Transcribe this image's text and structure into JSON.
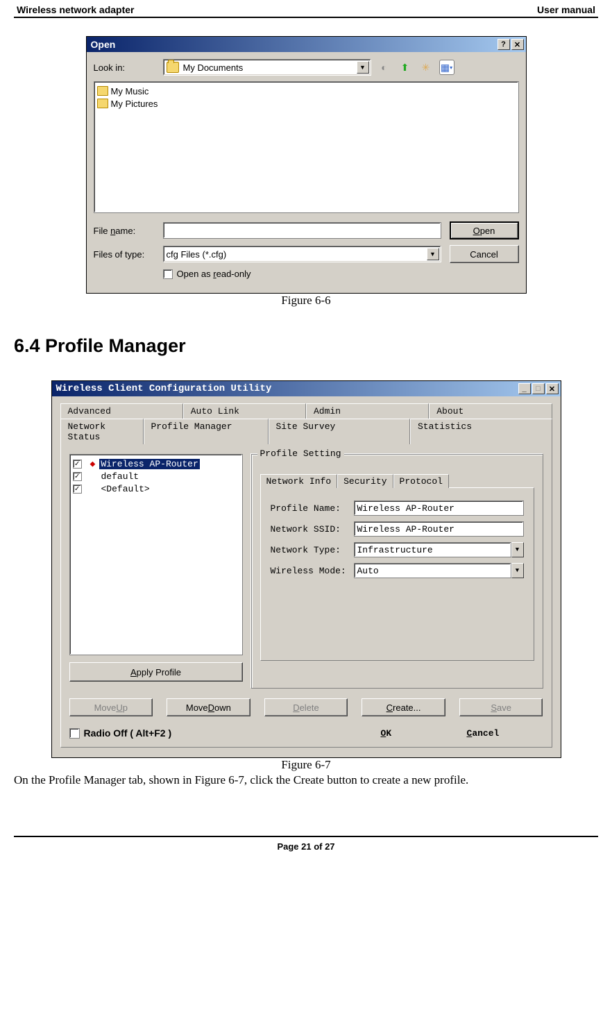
{
  "header": {
    "left": "Wireless network adapter",
    "right": "User manual"
  },
  "open_dialog": {
    "title": "Open",
    "look_in_label": "Look in:",
    "look_in_value": "My Documents",
    "files": [
      "My Music",
      "My Pictures"
    ],
    "filename_label": "File name:",
    "filename_value": "",
    "filetype_label": "Files of type:",
    "filetype_value": "cfg Files (*.cfg)",
    "readonly_label": "Open as read-only",
    "open_btn": "Open",
    "cancel_btn": "Cancel"
  },
  "fig1_caption": "Figure 6-6",
  "section_heading": "6.4 Profile Manager",
  "pm_dialog": {
    "title": "Wireless Client Configuration Utility",
    "tabs_top": [
      "Advanced",
      "Auto Link",
      "Admin",
      "About"
    ],
    "tabs_bottom": [
      "Network Status",
      "Profile Manager",
      "Site Survey",
      "Statistics"
    ],
    "profiles": [
      {
        "name": "Wireless AP-Router",
        "selected": true,
        "marked": true
      },
      {
        "name": "default",
        "selected": false,
        "marked": false
      },
      {
        "name": "<Default>",
        "selected": false,
        "marked": false
      }
    ],
    "apply_btn": "Apply Profile",
    "groupbox_title": "Profile Setting",
    "inner_tabs": [
      "Network Info",
      "Security",
      "Protocol"
    ],
    "fields": {
      "profile_name_label": "Profile Name:",
      "profile_name_value": "Wireless AP-Router",
      "ssid_label": "Network SSID:",
      "ssid_value": "Wireless AP-Router",
      "type_label": "Network Type:",
      "type_value": "Infrastructure",
      "mode_label": "Wireless Mode:",
      "mode_value": "Auto"
    },
    "buttons": {
      "move_up": "Move Up",
      "move_down": "Move Down",
      "delete": "Delete",
      "create": "Create...",
      "save": "Save"
    },
    "radio_off": "Radio Off  ( Alt+F2 )",
    "ok": "OK",
    "cancel": "Cancel"
  },
  "fig2_caption": "Figure 6-7",
  "body_text": "On the Profile Manager tab, shown in Figure 6-7, click the Create button to create a new profile.",
  "footer": "Page 21 of 27"
}
